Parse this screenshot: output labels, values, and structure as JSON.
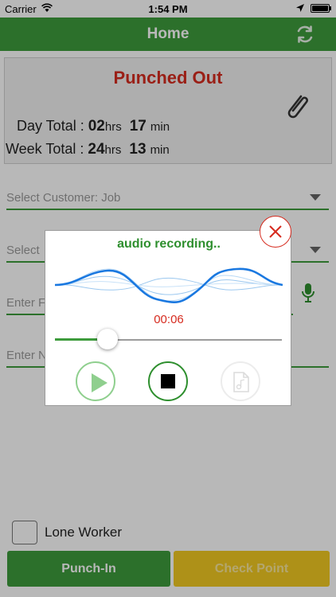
{
  "status_bar": {
    "carrier": "Carrier",
    "time": "1:54 PM"
  },
  "navbar": {
    "title": "Home"
  },
  "punch_card": {
    "status": "Punched Out",
    "day_total": {
      "label": "Day Total :",
      "hours": "02",
      "hours_unit": "hrs",
      "minutes": "17",
      "minutes_unit": "min"
    },
    "week_total": {
      "label": "Week Total :",
      "hours": "24",
      "hours_unit": "hrs",
      "minutes": "13",
      "minutes_unit": "min"
    }
  },
  "form": {
    "customer_job_placeholder": "Select Customer: Job",
    "field2_placeholder": "Select",
    "field3_placeholder": "Enter F",
    "field4_placeholder": "Enter N"
  },
  "lone_worker": {
    "label": "Lone Worker",
    "checked": false
  },
  "buttons": {
    "punch_in": "Punch-In",
    "check_point": "Check Point"
  },
  "recorder": {
    "title": "audio recording..",
    "elapsed": "00:06",
    "progress_fraction": 0.23
  },
  "colors": {
    "brand_green": "#3d9b3c",
    "alert_red": "#d62b1f",
    "wave_blue": "#1a78e0",
    "disabled_yellow": "#f2c922"
  }
}
